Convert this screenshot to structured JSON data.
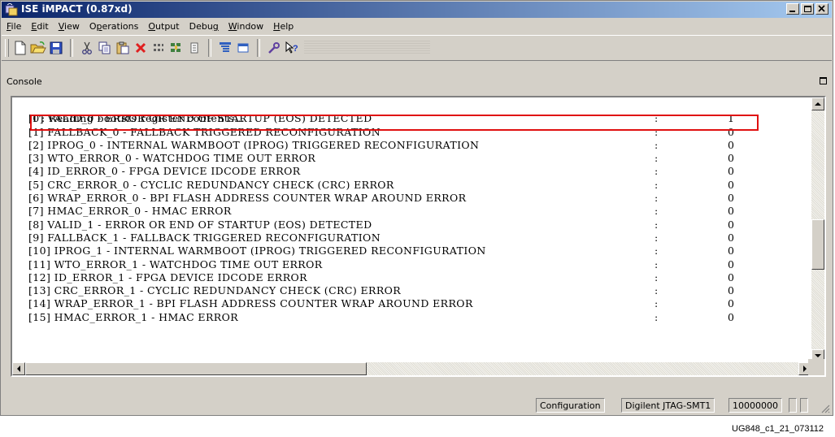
{
  "window": {
    "title": "ISE iMPACT (0.87xd)",
    "minimize_icon": "minimize-icon",
    "maximize_icon": "maximize-icon",
    "close_icon": "close-icon"
  },
  "menu": {
    "items": [
      "File",
      "Edit",
      "View",
      "Operations",
      "Output",
      "Debug",
      "Window",
      "Help"
    ],
    "underline_index": [
      0,
      0,
      0,
      1,
      0,
      4,
      0,
      0
    ]
  },
  "toolbar": {
    "icons": [
      "new-file-icon",
      "open-folder-icon",
      "save-icon",
      "cut-icon",
      "copy-icon",
      "paste-icon",
      "delete-icon",
      "grid-icon",
      "tile-icon",
      "list-icon",
      "cascade-icon",
      "window-icon",
      "wrench-icon",
      "help-pointer-icon"
    ]
  },
  "panel": {
    "title": "Console"
  },
  "console": {
    "header_line": "'1': Reading bootsts register contents...",
    "rows": [
      {
        "text": "[0] VALID_0 - ERROR OR END OF STARTUP (EOS) DETECTED",
        "colon": ":",
        "value": "1"
      },
      {
        "text": "[1] FALLBACK_0 - FALLBACK TRIGGERED RECONFIGURATION",
        "colon": ":",
        "value": "0"
      },
      {
        "text": "[2] IPROG_0 - INTERNAL WARMBOOT (IPROG) TRIGGERED RECONFIGURATION",
        "colon": ":",
        "value": "0"
      },
      {
        "text": "[3] WTO_ERROR_0 - WATCHDOG TIME OUT ERROR",
        "colon": ":",
        "value": "0"
      },
      {
        "text": "[4] ID_ERROR_0 - FPGA DEVICE IDCODE ERROR",
        "colon": ":",
        "value": "0"
      },
      {
        "text": "[5] CRC_ERROR_0 - CYCLIC REDUNDANCY CHECK (CRC) ERROR",
        "colon": ":",
        "value": "0"
      },
      {
        "text": "[6] WRAP_ERROR_0 - BPI FLASH ADDRESS COUNTER WRAP AROUND ERROR",
        "colon": ":",
        "value": "0"
      },
      {
        "text": "[7] HMAC_ERROR_0 - HMAC ERROR",
        "colon": ":",
        "value": "0"
      },
      {
        "text": "[8] VALID_1 - ERROR OR END OF STARTUP (EOS) DETECTED",
        "colon": ":",
        "value": "0"
      },
      {
        "text": "[9] FALLBACK_1 - FALLBACK TRIGGERED RECONFIGURATION",
        "colon": ":",
        "value": "0"
      },
      {
        "text": "[10] IPROG_1 - INTERNAL WARMBOOT (IPROG) TRIGGERED RECONFIGURATION",
        "colon": ":",
        "value": "0"
      },
      {
        "text": "[11] WTO_ERROR_1 - WATCHDOG TIME OUT ERROR",
        "colon": ":",
        "value": "0"
      },
      {
        "text": "[12] ID_ERROR_1 - FPGA DEVICE IDCODE ERROR",
        "colon": ":",
        "value": "0"
      },
      {
        "text": "[13] CRC_ERROR_1 - CYCLIC REDUNDANCY CHECK (CRC) ERROR",
        "colon": ":",
        "value": "0"
      },
      {
        "text": "[14] WRAP_ERROR_1 - BPI FLASH ADDRESS COUNTER WRAP AROUND ERROR",
        "colon": ":",
        "value": "0"
      },
      {
        "text": "[15] HMAC_ERROR_1 - HMAC ERROR",
        "colon": ":",
        "value": "0"
      }
    ],
    "highlight_color": "#e01010"
  },
  "statusbar": {
    "mode": "Configuration",
    "cable": "Digilent JTAG-SMT1",
    "speed": "10000000"
  },
  "footer": {
    "figure_id": "UG848_c1_21_073112"
  }
}
